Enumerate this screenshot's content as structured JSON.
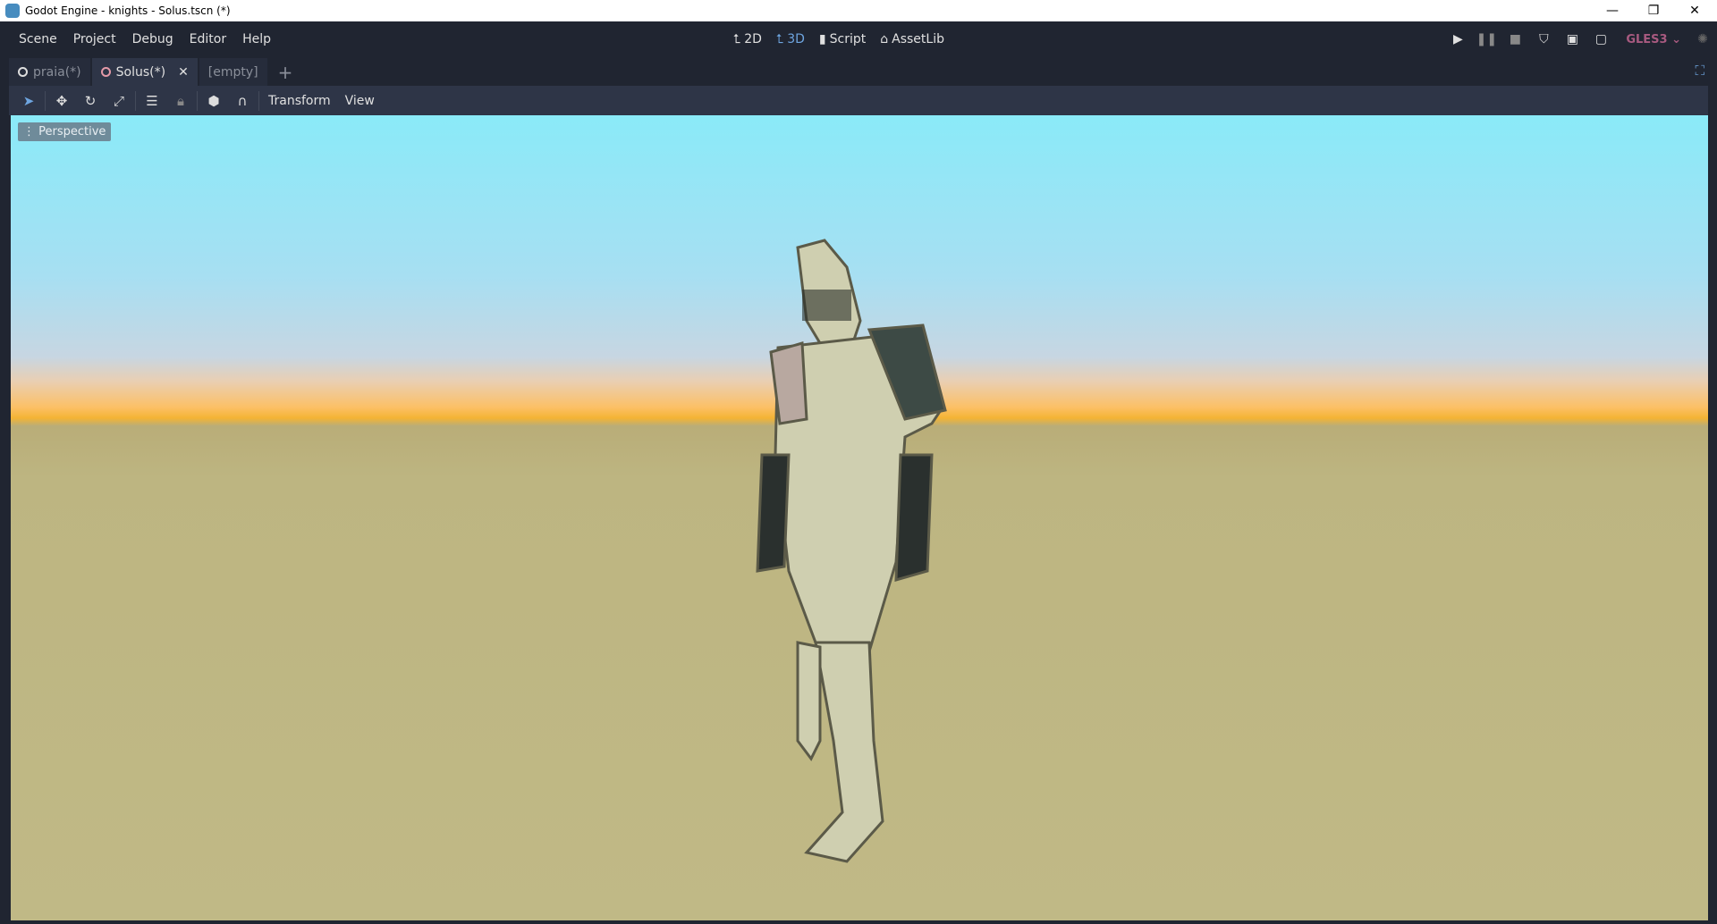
{
  "window": {
    "title": "Godot Engine - knights - Solus.tscn (*)",
    "minimize": "—",
    "restore": "❐",
    "close": "✕"
  },
  "menu": [
    "Scene",
    "Project",
    "Debug",
    "Editor",
    "Help"
  ],
  "workspaces": [
    {
      "label": "2D",
      "icon": "⮤"
    },
    {
      "label": "3D",
      "icon": "⮤"
    },
    {
      "label": "Script",
      "icon": "▮"
    },
    {
      "label": "AssetLib",
      "icon": "⌂"
    }
  ],
  "renderer": "GLES3",
  "tabs": [
    {
      "label": "praia(*)"
    },
    {
      "label": "Solus(*)"
    },
    {
      "label": "[empty]"
    }
  ],
  "tab_close": "✕",
  "tab_add": "+",
  "toolbar": {
    "transform": "Transform",
    "view": "View"
  },
  "viewport": {
    "mode": "Perspective"
  },
  "colors": {
    "accent": "#6ea5e0",
    "renderer": "#a85a80"
  }
}
